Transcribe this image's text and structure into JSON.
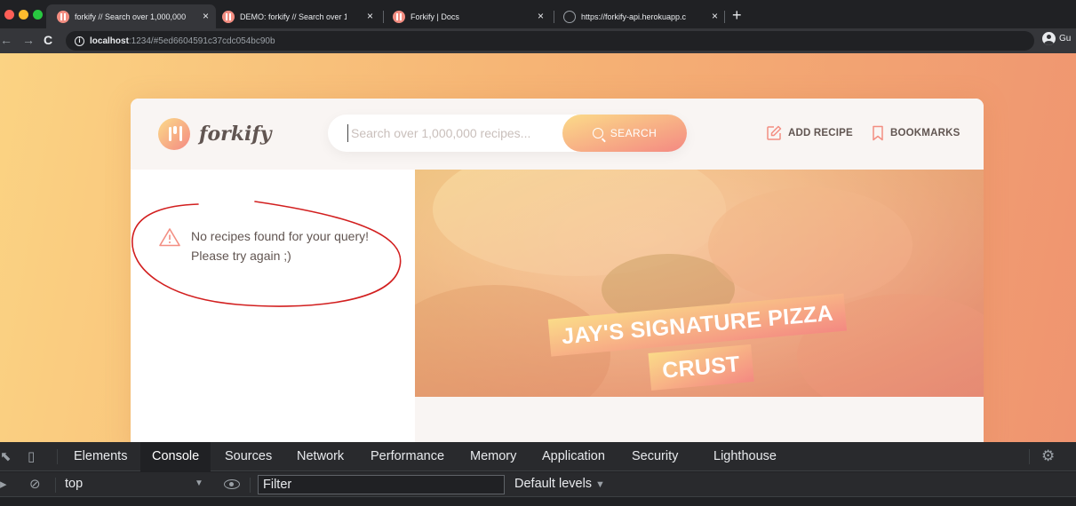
{
  "browser": {
    "tabs": [
      {
        "title": "forkify // Search over 1,000,000",
        "close": "×",
        "active": true
      },
      {
        "title": "DEMO: forkify // Search over 1,",
        "close": "×",
        "active": false
      },
      {
        "title": "Forkify | Docs",
        "close": "×",
        "active": false
      },
      {
        "title": "https://forkify-api.herokuapp.c",
        "close": "×",
        "active": false
      }
    ],
    "new_tab": "+",
    "url_host": "localhost",
    "url_rest": ":1234/#5ed6604591c37cdc054bc90b",
    "profile_label": "Gu",
    "traffic_colors": [
      "#ff5f57",
      "#febc2e",
      "#28c840"
    ]
  },
  "app": {
    "logo_text": "forkify",
    "search": {
      "placeholder": "Search over 1,000,000 recipes...",
      "button_label": "SEARCH"
    },
    "nav": {
      "add_recipe": "ADD RECIPE",
      "bookmarks": "BOOKMARKS"
    },
    "results": {
      "error_message": "No recipes found for your query! Please try again ;)"
    },
    "recipe": {
      "title_line1": "JAY'S SIGNATURE PIZZA",
      "title_line2": "CRUST"
    },
    "colors": {
      "gradient_start": "#fbdb89",
      "gradient_end": "#f48982",
      "text": "#615551",
      "annotation": "#d21f1f"
    }
  },
  "devtools": {
    "tabs": [
      "Elements",
      "Console",
      "Sources",
      "Network",
      "Performance",
      "Memory",
      "Application",
      "Security",
      "Lighthouse"
    ],
    "active_tab": "Console",
    "context": "top",
    "filter_placeholder": "Filter",
    "levels": "Default levels"
  }
}
